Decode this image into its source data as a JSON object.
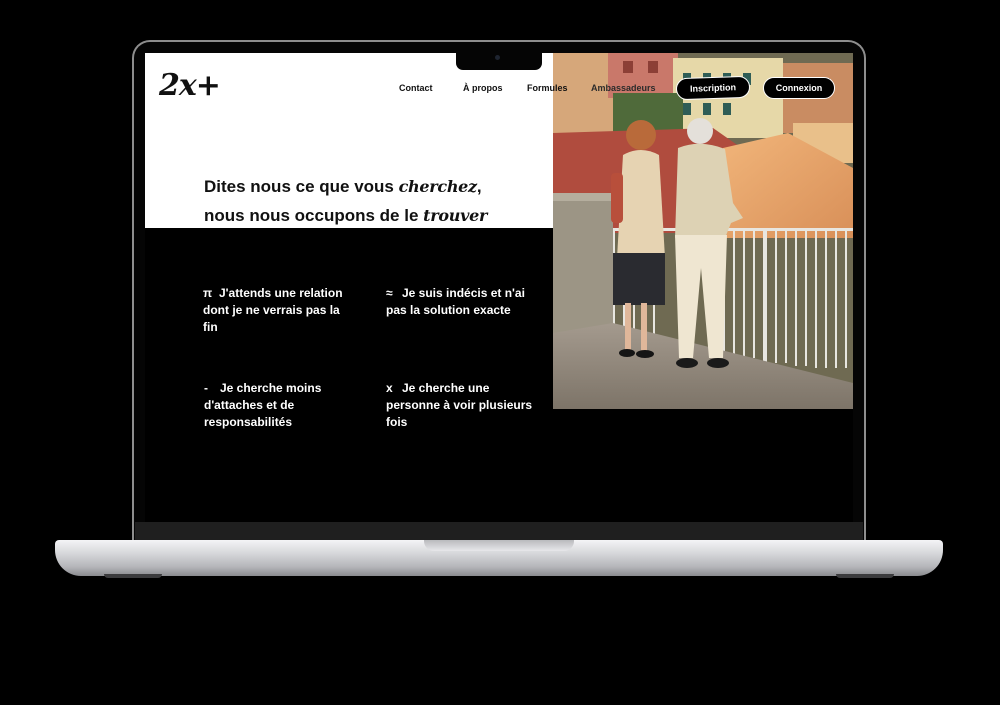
{
  "site": {
    "logo": "2x+",
    "nav": {
      "contact": "Contact",
      "apropos": "À propos",
      "formules": "Formules",
      "ambassadeurs": "Ambassadeurs"
    },
    "buttons": {
      "inscription": "Inscription",
      "connexion": "Connexion"
    }
  },
  "hero": {
    "line1_text": "Dites nous ce que vous ",
    "line1_script": "cherchez",
    "line1_end": ",",
    "line2_text": "nous nous occupons de le ",
    "line2_script": "trouver"
  },
  "options": [
    {
      "symbol": "π",
      "label": "J'attends une relation dont je ne verrais pas la fin"
    },
    {
      "symbol": "≈",
      "label": "Je suis indécis et n'ai pas la solution exacte"
    },
    {
      "symbol": "-",
      "label": "Je cherche moins d'attaches et de responsabilités"
    },
    {
      "symbol": "x",
      "label": "Je cherche une personne à voir plusieurs fois"
    }
  ],
  "colors": {
    "background": "#000000",
    "panel": "#ffffff",
    "text_dark": "#111111",
    "text_light": "#ffffff"
  },
  "icons": {
    "photo": "elderly-couple-balcony-photo"
  }
}
